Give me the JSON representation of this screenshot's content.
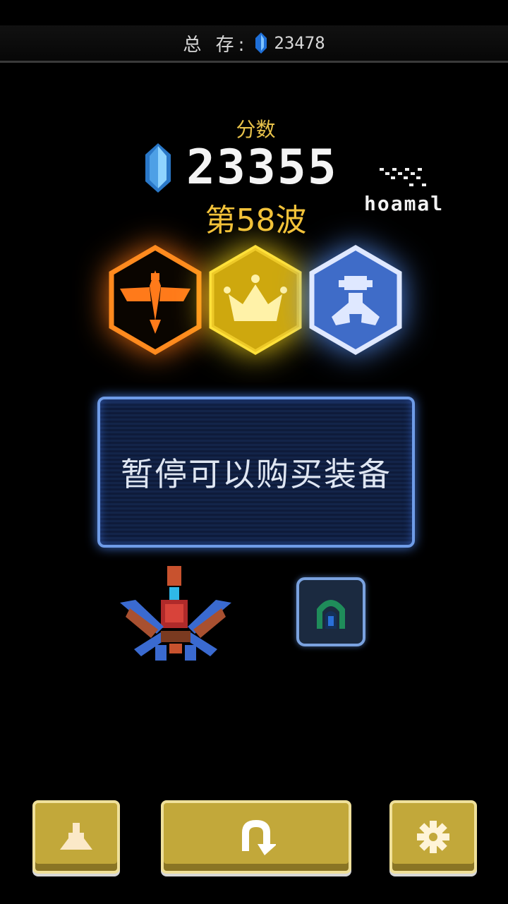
{
  "top_bar": {
    "total_label": "总 存:",
    "total_value": "23478"
  },
  "score": {
    "label": "分数",
    "value": "23355",
    "wave_label": "第58波"
  },
  "difficulty": {
    "label": "hoamal"
  },
  "medals": [
    {
      "name": "phoenix",
      "color": "#ff8a1e"
    },
    {
      "name": "crown",
      "color": "#ffe13a"
    },
    {
      "name": "fighter",
      "color": "#6ea0ff"
    }
  ],
  "pause_message": "暂停可以购买装备",
  "buttons": {
    "ship": "ship-icon",
    "restart": "restart-icon",
    "settings": "gear-icon"
  },
  "colors": {
    "accent_gold": "#f2c23a",
    "panel_blue": "#6f9ce8",
    "button_gold": "#c2a83a"
  }
}
